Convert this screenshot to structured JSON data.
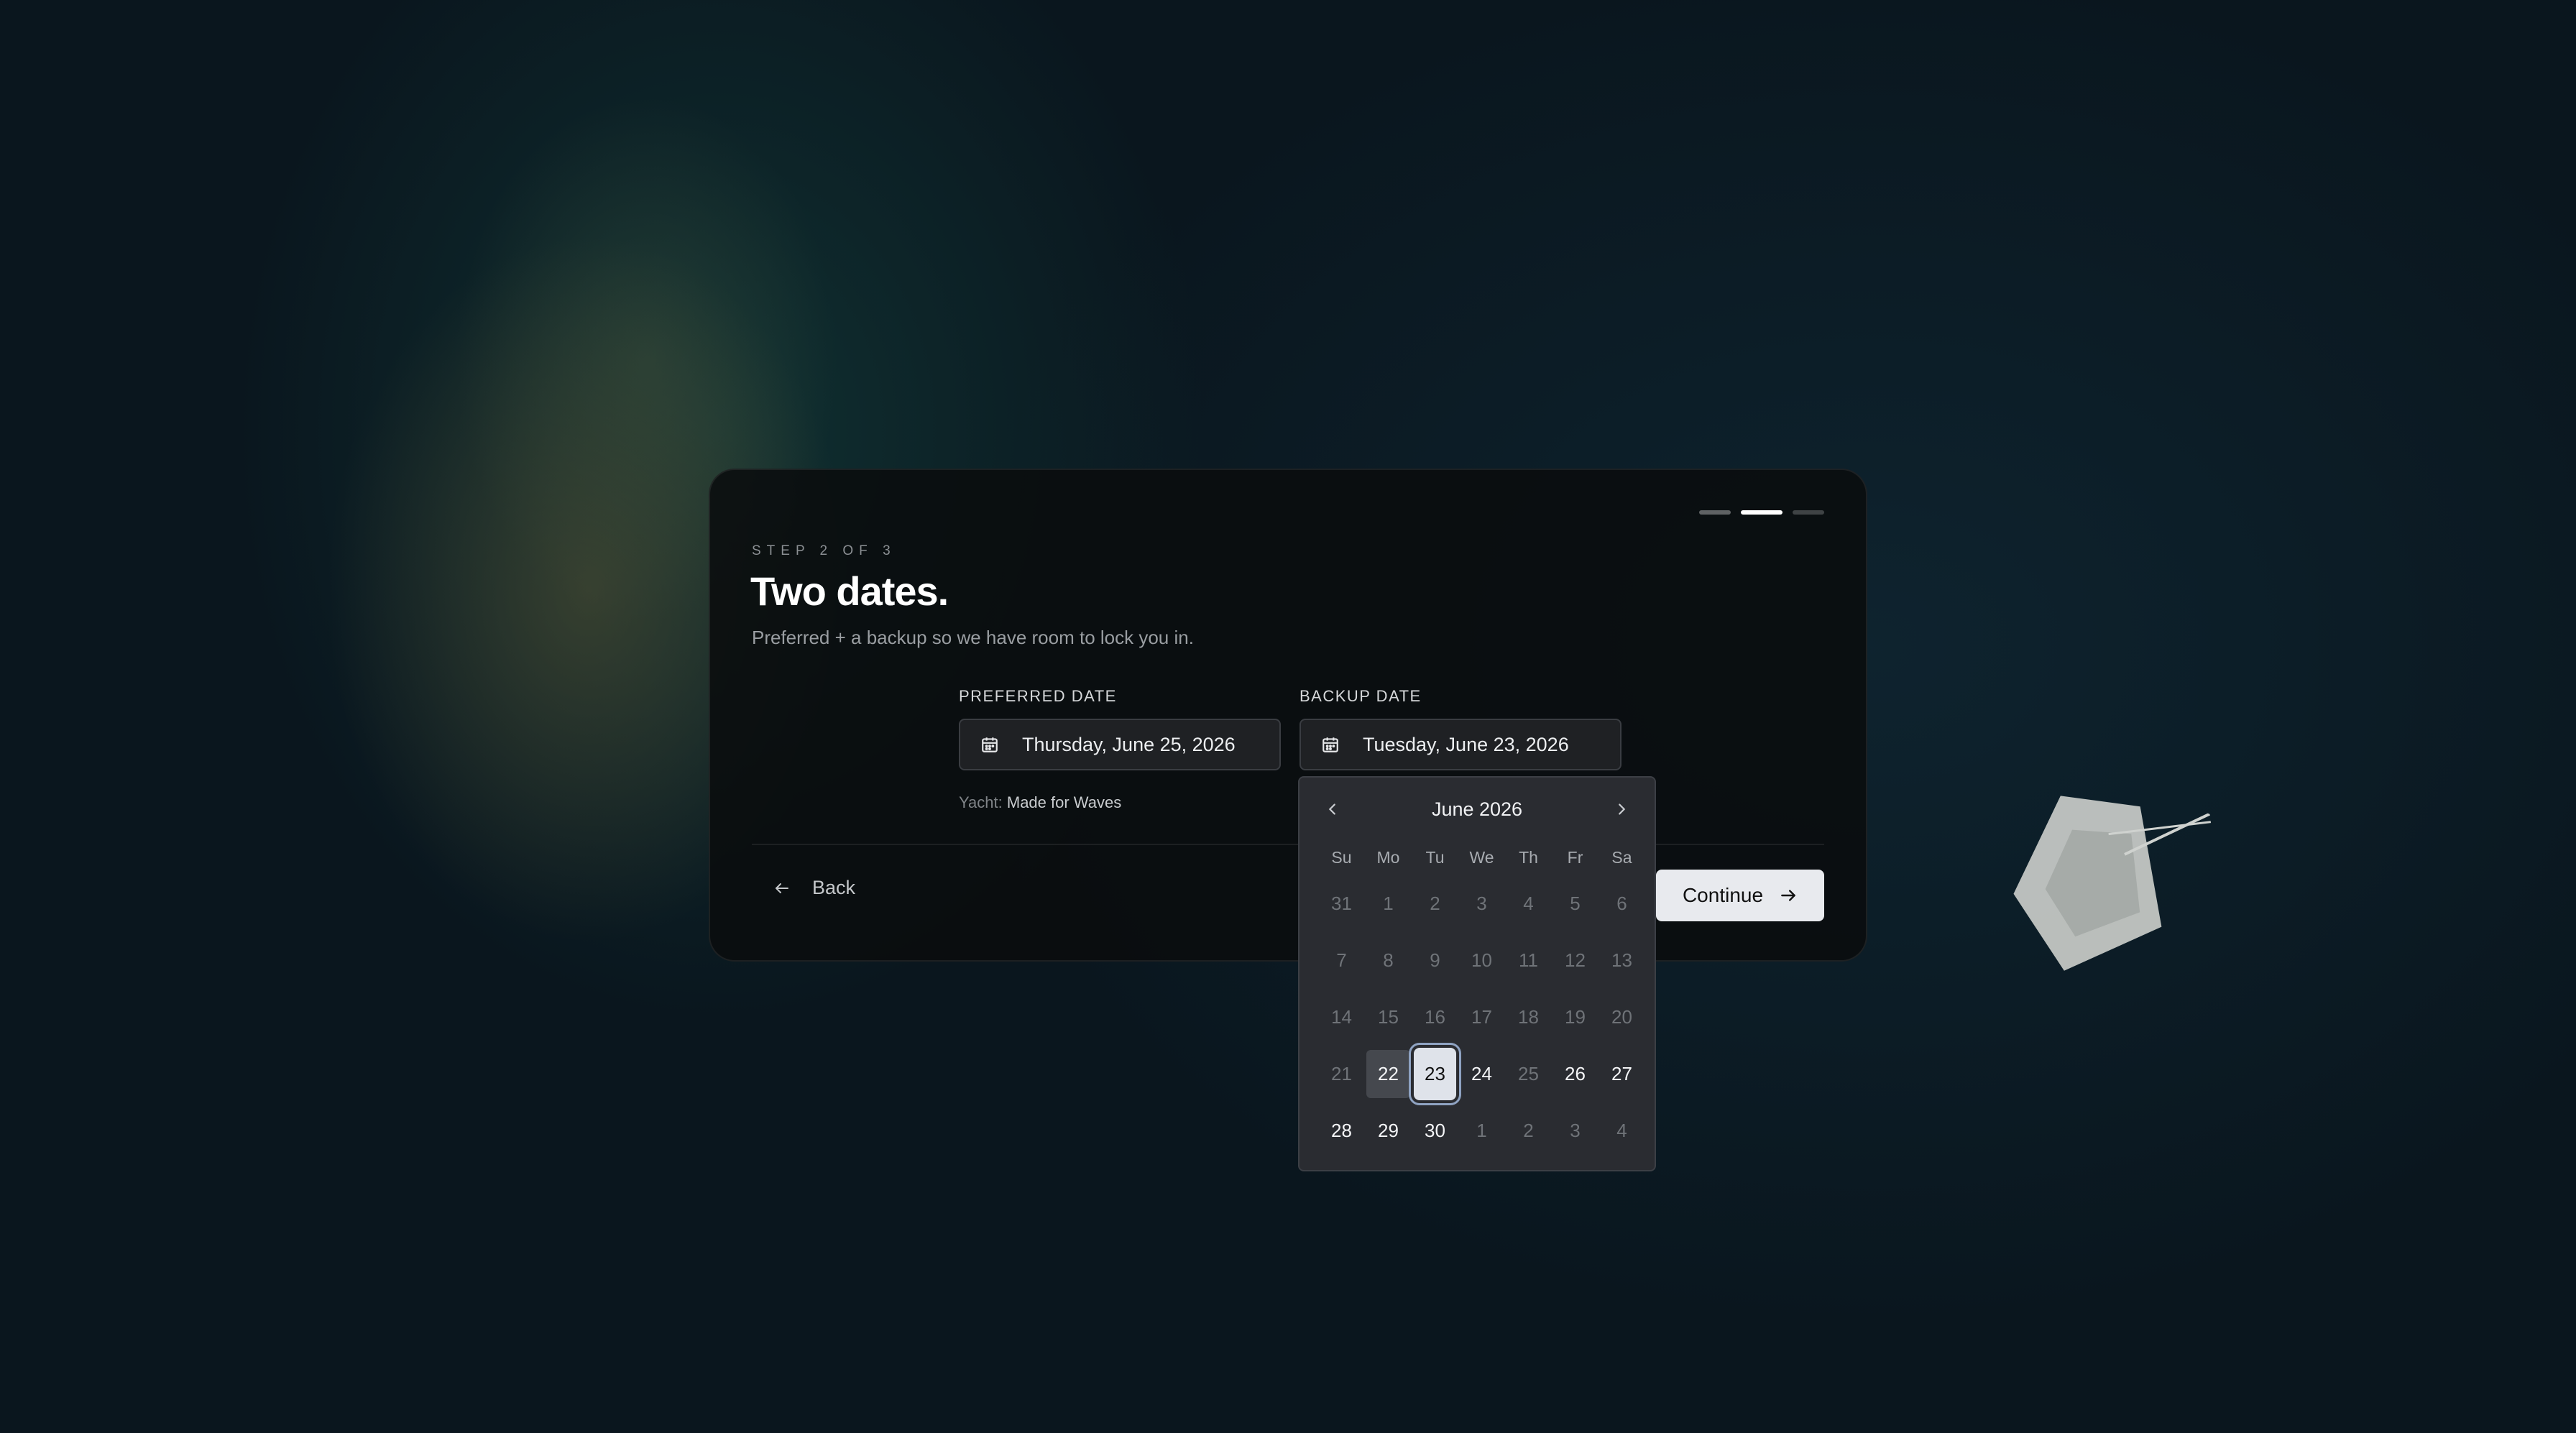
{
  "wizard": {
    "step_label": "STEP 2 OF 3",
    "title": "Two dates.",
    "subtitle": "Preferred + a backup so we have room to lock you in.",
    "progress": {
      "total": 3,
      "current": 2
    }
  },
  "preferred": {
    "label": "PREFERRED DATE",
    "value": "Thursday, June 25, 2026"
  },
  "backup": {
    "label": "BACKUP DATE",
    "value": "Tuesday, June 23, 2026"
  },
  "yacht": {
    "label": "Yacht:",
    "name": "Made for Waves"
  },
  "actions": {
    "back_label": "Back",
    "continue_label": "Continue"
  },
  "calendar": {
    "month_label": "June 2026",
    "weekdays": [
      "Su",
      "Mo",
      "Tu",
      "We",
      "Th",
      "Fr",
      "Sa"
    ],
    "days": [
      {
        "n": "31",
        "state": "out"
      },
      {
        "n": "1",
        "state": "disabled"
      },
      {
        "n": "2",
        "state": "disabled"
      },
      {
        "n": "3",
        "state": "disabled"
      },
      {
        "n": "4",
        "state": "disabled"
      },
      {
        "n": "5",
        "state": "disabled"
      },
      {
        "n": "6",
        "state": "disabled"
      },
      {
        "n": "7",
        "state": "disabled"
      },
      {
        "n": "8",
        "state": "disabled"
      },
      {
        "n": "9",
        "state": "disabled"
      },
      {
        "n": "10",
        "state": "disabled"
      },
      {
        "n": "11",
        "state": "disabled"
      },
      {
        "n": "12",
        "state": "disabled"
      },
      {
        "n": "13",
        "state": "disabled"
      },
      {
        "n": "14",
        "state": "disabled"
      },
      {
        "n": "15",
        "state": "disabled"
      },
      {
        "n": "16",
        "state": "disabled"
      },
      {
        "n": "17",
        "state": "disabled"
      },
      {
        "n": "18",
        "state": "disabled"
      },
      {
        "n": "19",
        "state": "disabled"
      },
      {
        "n": "20",
        "state": "disabled"
      },
      {
        "n": "21",
        "state": "disabled"
      },
      {
        "n": "22",
        "state": "range"
      },
      {
        "n": "23",
        "state": "selected"
      },
      {
        "n": "24",
        "state": "avail"
      },
      {
        "n": "25",
        "state": "disabled"
      },
      {
        "n": "26",
        "state": "avail"
      },
      {
        "n": "27",
        "state": "avail"
      },
      {
        "n": "28",
        "state": "avail"
      },
      {
        "n": "29",
        "state": "avail"
      },
      {
        "n": "30",
        "state": "avail"
      },
      {
        "n": "1",
        "state": "out"
      },
      {
        "n": "2",
        "state": "out"
      },
      {
        "n": "3",
        "state": "out"
      },
      {
        "n": "4",
        "state": "out"
      }
    ]
  },
  "colors": {
    "accent": "#e8eaee",
    "selected_ring": "#8fa3c2",
    "panel": "#2a2c31"
  },
  "icons": {
    "calendar": "calendar-icon",
    "back": "arrow-left-icon",
    "continue": "arrow-right-icon",
    "prev": "chevron-left-icon",
    "next": "chevron-right-icon"
  }
}
